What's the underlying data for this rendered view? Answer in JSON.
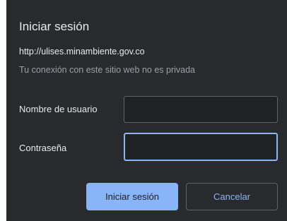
{
  "dialog": {
    "title": "Iniciar sesión",
    "url": "http://ulises.minambiente.gov.co",
    "warning": "Tu conexión con este sitio web no es privada"
  },
  "form": {
    "username_label": "Nombre de usuario",
    "username_value": "",
    "password_label": "Contraseña",
    "password_value": ""
  },
  "buttons": {
    "signin_label": "Iniciar sesión",
    "cancel_label": "Cancelar"
  },
  "colors": {
    "dialog_background": "#292a2d",
    "accent": "#8ab4f8",
    "text_primary": "#e8eaed",
    "text_secondary": "#9aa0a6"
  }
}
